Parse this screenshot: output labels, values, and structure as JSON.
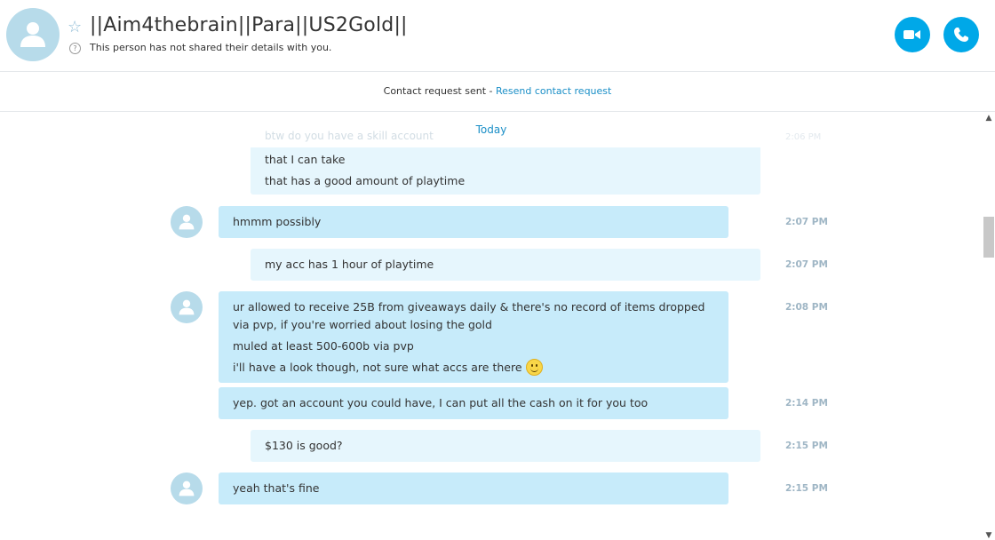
{
  "header": {
    "contact_name": "||Aim4thebrain||Para||US2Gold||",
    "subtitle": "This person has not shared their details with you.",
    "video_icon": "video-camera-icon",
    "call_icon": "phone-icon",
    "favorite_icon": "star-icon"
  },
  "request_bar": {
    "text": "Contact request sent - ",
    "link": "Resend contact request"
  },
  "chat": {
    "day_label": "Today",
    "faded_line": "btw do you have a skill account",
    "faded_time": "2:06 PM",
    "messages": [
      {
        "side": "out",
        "lines": [
          "that I can take",
          "that has a good amount of playtime"
        ],
        "time": ""
      },
      {
        "side": "in",
        "lines": [
          "hmmm possibly"
        ],
        "time": "2:07 PM"
      },
      {
        "side": "out",
        "lines": [
          "my acc has 1 hour of playtime"
        ],
        "time": "2:07 PM"
      },
      {
        "side": "in",
        "lines": [
          "ur allowed to receive 25B from giveaways daily & there's no record of items dropped via pvp, if you're worried about losing the gold",
          "muled at least 500-600b via pvp",
          "i'll have a look though, not sure what accs are there"
        ],
        "time": "2:08 PM",
        "emoji": "smile-emoji"
      },
      {
        "side": "in",
        "lines": [
          "yep. got an account you could have, I can put all the cash on it for you too"
        ],
        "time": "2:14 PM"
      },
      {
        "side": "out",
        "lines": [
          "$130 is good?"
        ],
        "time": "2:15 PM"
      },
      {
        "side": "in",
        "lines": [
          "yeah that's fine"
        ],
        "time": "2:15 PM"
      }
    ]
  },
  "colors": {
    "accent": "#00a8e8",
    "link": "#1b8fc7",
    "incoming_bubble": "#c7ebfa",
    "outgoing_bubble": "#e6f6fd",
    "avatar": "#b7dbea"
  }
}
